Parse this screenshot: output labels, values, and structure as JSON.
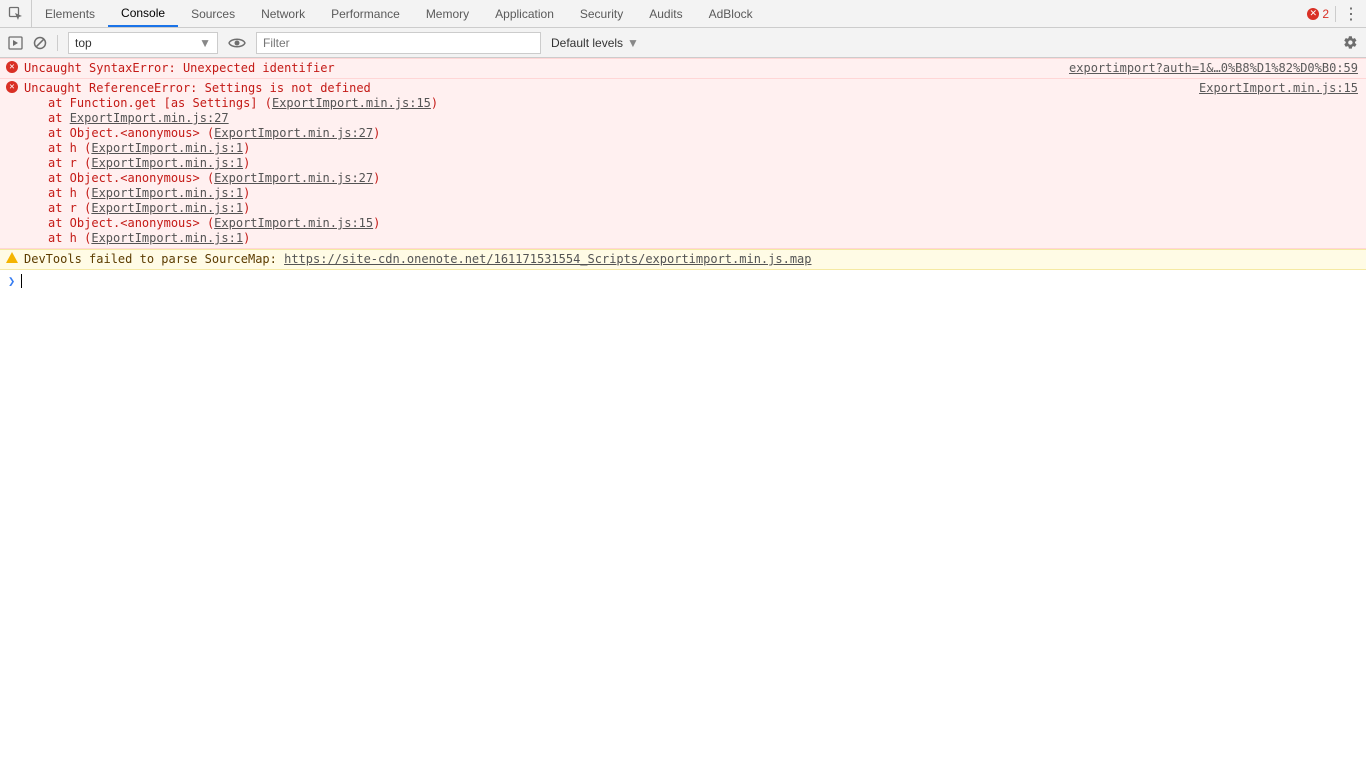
{
  "header": {
    "tabs": [
      "Elements",
      "Console",
      "Sources",
      "Network",
      "Performance",
      "Memory",
      "Application",
      "Security",
      "Audits",
      "AdBlock"
    ],
    "active_tab_index": 1,
    "error_count": "2"
  },
  "toolbar": {
    "context": "top",
    "filter_placeholder": "Filter",
    "levels_label": "Default levels"
  },
  "messages": [
    {
      "type": "error",
      "text": "Uncaught SyntaxError: Unexpected identifier",
      "location": "exportimport?auth=1&…0%B8%D1%82%D0%B0:59",
      "stack": []
    },
    {
      "type": "error",
      "text": "Uncaught ReferenceError: Settings is not defined",
      "location": "ExportImport.min.js:15",
      "stack": [
        {
          "pre": "    at Function.get [as Settings] (",
          "link": "ExportImport.min.js:15",
          "post": ")"
        },
        {
          "pre": "    at ",
          "link": "ExportImport.min.js:27",
          "post": ""
        },
        {
          "pre": "    at Object.<anonymous> (",
          "link": "ExportImport.min.js:27",
          "post": ")"
        },
        {
          "pre": "    at h (",
          "link": "ExportImport.min.js:1",
          "post": ")"
        },
        {
          "pre": "    at r (",
          "link": "ExportImport.min.js:1",
          "post": ")"
        },
        {
          "pre": "    at Object.<anonymous> (",
          "link": "ExportImport.min.js:27",
          "post": ")"
        },
        {
          "pre": "    at h (",
          "link": "ExportImport.min.js:1",
          "post": ")"
        },
        {
          "pre": "    at r (",
          "link": "ExportImport.min.js:1",
          "post": ")"
        },
        {
          "pre": "    at Object.<anonymous> (",
          "link": "ExportImport.min.js:15",
          "post": ")"
        },
        {
          "pre": "    at h (",
          "link": "ExportImport.min.js:1",
          "post": ")"
        }
      ]
    },
    {
      "type": "warning",
      "text": "DevTools failed to parse SourceMap: ",
      "link": "https://site-cdn.onenote.net/161171531554_Scripts/exportimport.min.js.map",
      "location": "",
      "stack": []
    }
  ],
  "prompt": {
    "chevron": "❯"
  }
}
